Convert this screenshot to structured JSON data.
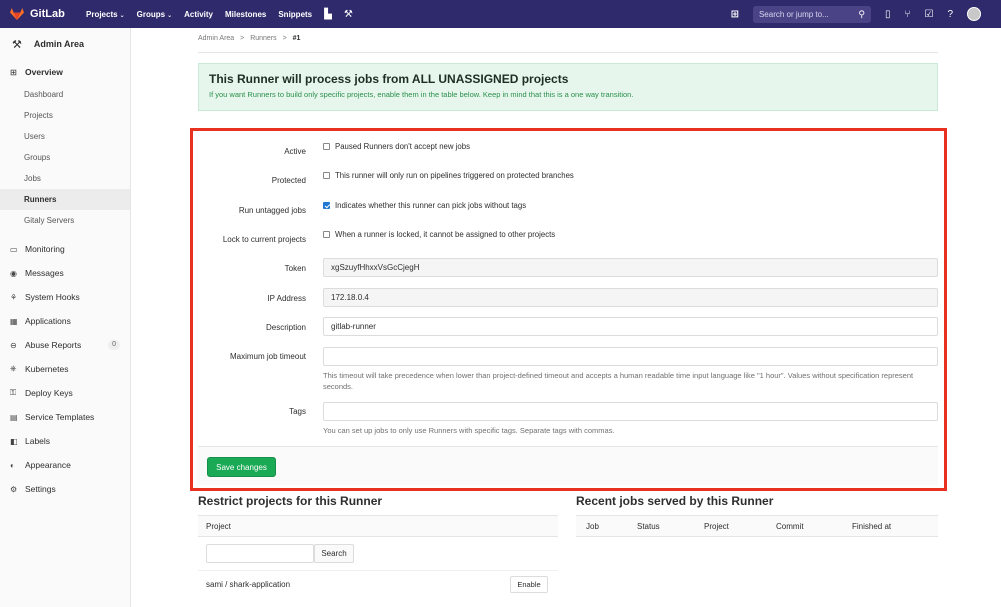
{
  "topbar": {
    "logo_text": "GitLab",
    "nav": [
      {
        "label": "Projects",
        "caret": "⌄"
      },
      {
        "label": "Groups",
        "caret": "⌄"
      },
      {
        "label": "Activity",
        "caret": ""
      },
      {
        "label": "Milestones",
        "caret": ""
      },
      {
        "label": "Snippets",
        "caret": ""
      }
    ],
    "search_placeholder": "Search or jump to...",
    "brand_color": "#2f2a6b"
  },
  "sidebar": {
    "header": "Admin Area",
    "overview": "Overview",
    "overview_items": [
      "Dashboard",
      "Projects",
      "Users",
      "Groups",
      "Jobs",
      "Runners",
      "Gitaly Servers"
    ],
    "sections": [
      {
        "label": "Monitoring",
        "icon": "monitor-icon"
      },
      {
        "label": "Messages",
        "icon": "broadcast-icon"
      },
      {
        "label": "System Hooks",
        "icon": "hook-icon"
      },
      {
        "label": "Applications",
        "icon": "applications-icon"
      },
      {
        "label": "Abuse Reports",
        "icon": "abuse-icon",
        "badge": "0"
      },
      {
        "label": "Kubernetes",
        "icon": "kubernetes-icon"
      },
      {
        "label": "Deploy Keys",
        "icon": "key-icon"
      },
      {
        "label": "Service Templates",
        "icon": "template-icon"
      },
      {
        "label": "Labels",
        "icon": "label-icon"
      },
      {
        "label": "Appearance",
        "icon": "appearance-icon"
      },
      {
        "label": "Settings",
        "icon": "settings-icon"
      }
    ]
  },
  "breadcrumb": {
    "items": [
      "Admin Area",
      "Runners"
    ],
    "current": "#1",
    "sep": ">"
  },
  "alert": {
    "title": "This Runner will process jobs from ALL UNASSIGNED projects",
    "body": "If you want Runners to build only specific projects, enable them in the table below. Keep in mind that this is a one way transition."
  },
  "form": {
    "active_label": "Active",
    "active_text": "Paused Runners don't accept new jobs",
    "protected_label": "Protected",
    "protected_text": "This runner will only run on pipelines triggered on protected branches",
    "untagged_label": "Run untagged jobs",
    "untagged_text": "Indicates whether this runner can pick jobs without tags",
    "locked_label": "Lock to current projects",
    "locked_text": "When a runner is locked, it cannot be assigned to other projects",
    "token_label": "Token",
    "token_value": "xgSzuyfHhxxVsGcCjegH",
    "ip_label": "IP Address",
    "ip_value": "172.18.0.4",
    "description_label": "Description",
    "description_value": "gitlab-runner",
    "timeout_label": "Maximum job timeout",
    "timeout_value": "",
    "timeout_help": "This timeout will take precedence when lower than project-defined timeout and accepts a human readable time input language like \"1 hour\". Values without specification represent seconds.",
    "tags_label": "Tags",
    "tags_value": "",
    "tags_help": "You can set up jobs to only use Runners with specific tags. Separate tags with commas.",
    "save_label": "Save changes"
  },
  "restrict": {
    "title": "Restrict projects for this Runner",
    "column": "Project",
    "search_button": "Search",
    "rows": [
      {
        "name": "sami / shark-application",
        "action": "Enable"
      }
    ]
  },
  "recent_jobs": {
    "title": "Recent jobs served by this Runner",
    "columns": [
      "Job",
      "Status",
      "Project",
      "Commit",
      "Finished at"
    ]
  }
}
